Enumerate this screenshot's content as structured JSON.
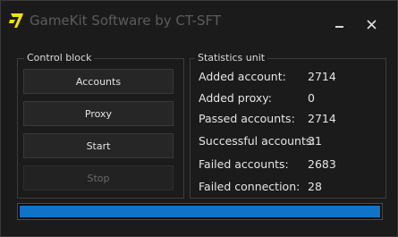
{
  "window": {
    "title": "GameKit Software by CT-SFT",
    "icon": "gamekit-app-icon"
  },
  "control_block": {
    "label": "Control block",
    "buttons": {
      "accounts": "Accounts",
      "proxy": "Proxy",
      "start": "Start",
      "stop": "Stop"
    },
    "stop_enabled": false
  },
  "statistics": {
    "label": "Statistics unit",
    "rows": [
      {
        "label": "Added account:",
        "value": "2714"
      },
      {
        "label": "Added proxy:",
        "value": "0"
      },
      {
        "label": "Passed accounts:",
        "value": "2714"
      },
      {
        "label": "Successful accounts:",
        "value": "31"
      },
      {
        "label": "Failed accounts:",
        "value": "2683"
      },
      {
        "label": "Failed connection:",
        "value": "28"
      }
    ]
  },
  "progress": {
    "fraction": 1.0
  },
  "colors": {
    "background": "#1b1b1b",
    "accent": "#0f74c8",
    "icon_yellow": "#f2e20c"
  }
}
